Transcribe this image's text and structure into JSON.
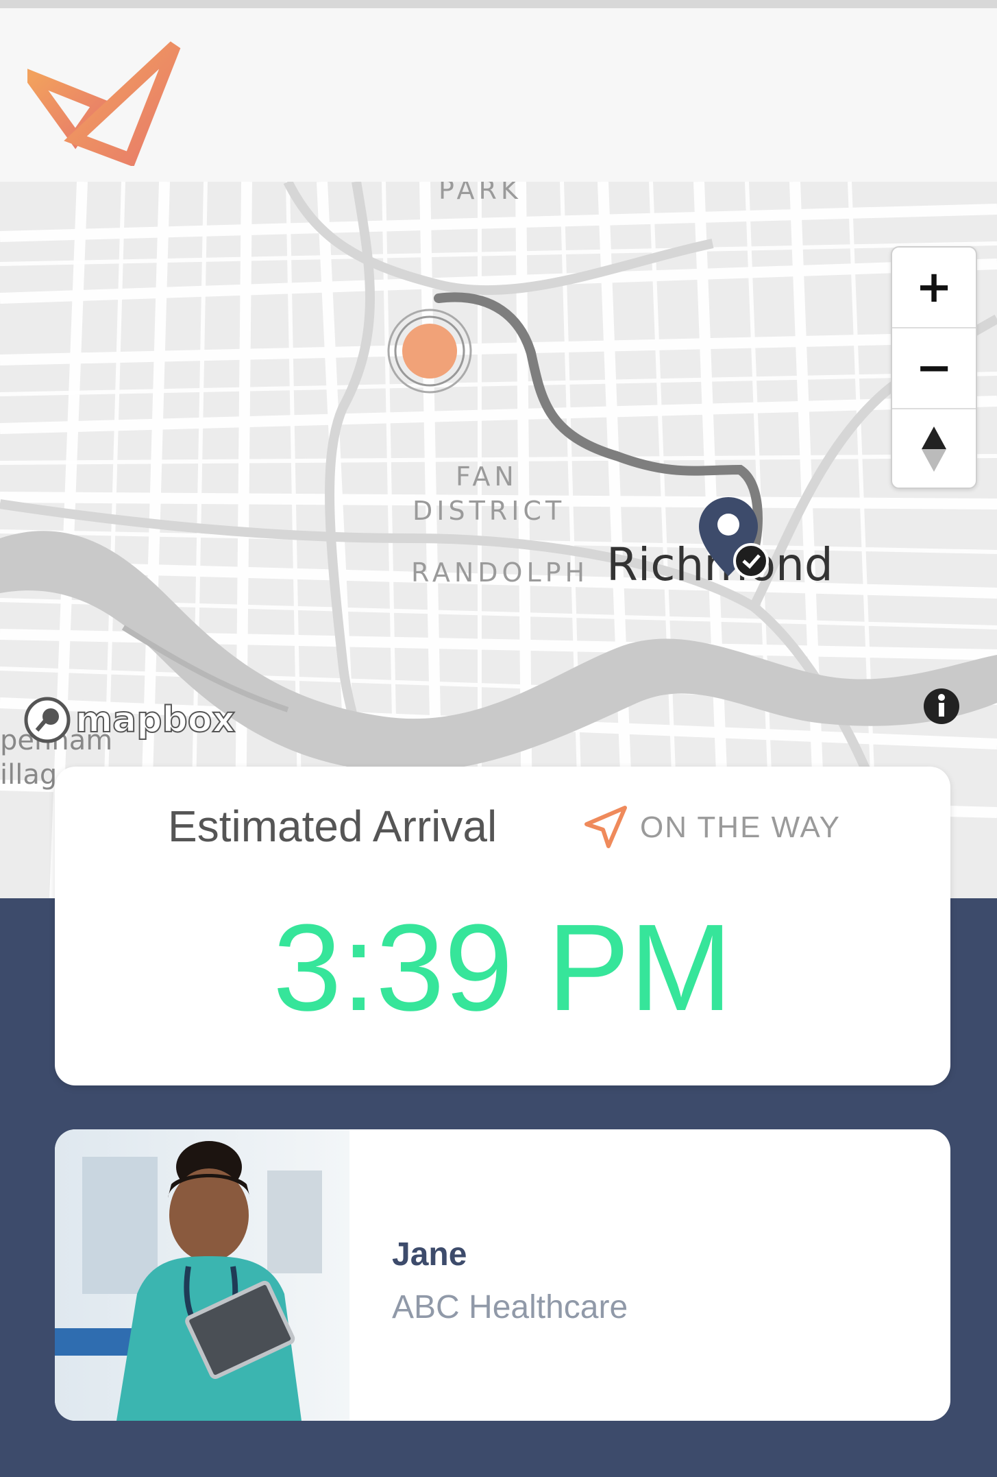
{
  "map": {
    "labels": {
      "park": "PARK",
      "fan": "FAN",
      "district": "DISTRICT",
      "randolph": "RANDOLPH",
      "city": "Richmond",
      "pennam": "pennam",
      "village": "illag"
    },
    "zoom_in": "+",
    "zoom_out": "−",
    "attribution": "mapbox"
  },
  "eta": {
    "title": "Estimated Arrival",
    "status": "ON THE WAY",
    "time": "3:39 PM"
  },
  "caregiver": {
    "name": "Jane",
    "organization": "ABC Healthcare"
  },
  "colors": {
    "accent": "#ef8a5b",
    "eta_green": "#36e59a",
    "panel_navy": "#3d4b6b"
  },
  "icons": [
    "brand-logo-icon",
    "navigation-arrow-icon",
    "compass-icon",
    "info-icon",
    "map-pin-icon",
    "current-location-icon"
  ]
}
